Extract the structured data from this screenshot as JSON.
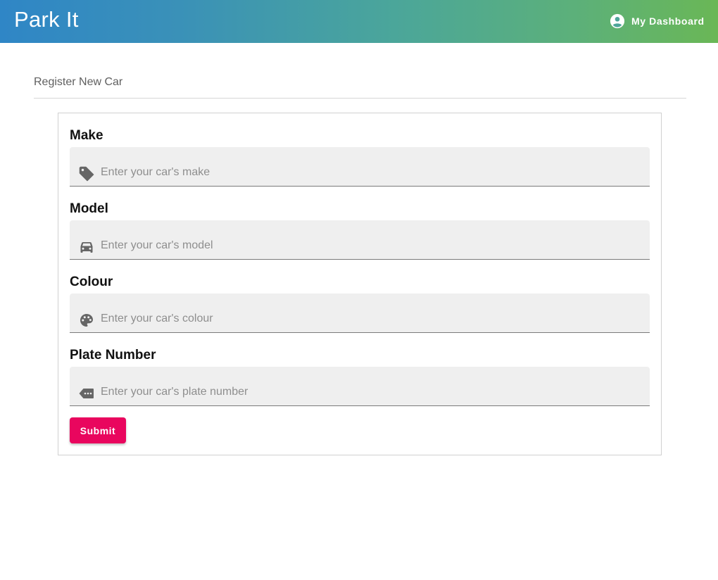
{
  "app": {
    "title": "Park It",
    "dashboard_label": "My Dashboard",
    "gradient": [
      "#2f86c6",
      "#6ab756"
    ]
  },
  "page": {
    "section_title": "Register New Car"
  },
  "form": {
    "fields": [
      {
        "label": "Make",
        "placeholder": "Enter your car's make",
        "value": "",
        "icon": "tag-icon"
      },
      {
        "label": "Model",
        "placeholder": "Enter your car's model",
        "value": "",
        "icon": "car-icon"
      },
      {
        "label": "Colour",
        "placeholder": "Enter your car's colour",
        "value": "",
        "icon": "palette-icon"
      },
      {
        "label": "Plate Number",
        "placeholder": "Enter your car's plate number",
        "value": "",
        "icon": "plate-icon"
      }
    ],
    "submit_label": "Submit",
    "submit_color": "#e9065e"
  }
}
